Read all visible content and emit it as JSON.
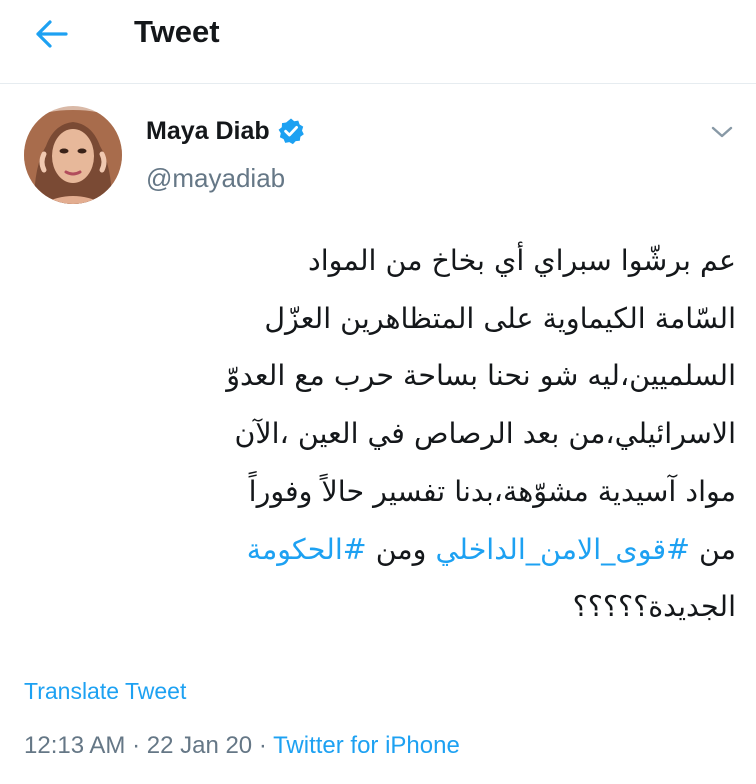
{
  "header": {
    "title": "Tweet",
    "back_icon": "arrow-left-icon"
  },
  "colors": {
    "accent": "#1da1f2",
    "text": "#14171a",
    "secondary_text": "#657786",
    "divider": "#e6ecf0"
  },
  "tweet": {
    "author": {
      "name": "Maya Diab",
      "handle": "@mayadiab",
      "verified": true
    },
    "caret_icon": "chevron-down-icon",
    "text_lines": [
      {
        "plain": "عم برشّوا سبراي أي بخاخ من المواد"
      },
      {
        "plain": "السّامة الكيماوية على المتظاهرين العزّل"
      },
      {
        "plain": "السلميين،ليه شو نحنا بساحة حرب مع العدوّ"
      },
      {
        "plain": "الاسرائيلي،من بعد الرصاص في العين ،الآن"
      },
      {
        "plain": "مواد آسيدية مشوّهة،بدنا تفسير حالاً وفوراً"
      },
      {
        "prefix": "من ",
        "hashtag1": "#قوى_الامن_الداخلي",
        "middle": " ومن ",
        "hashtag2": "#الحكومة"
      },
      {
        "plain": "الجديدة؟؟؟؟؟"
      }
    ],
    "translate_label": "Translate Tweet",
    "time": "12:13 AM",
    "separator": " · ",
    "date": "22 Jan 20",
    "source": "Twitter for iPhone"
  }
}
